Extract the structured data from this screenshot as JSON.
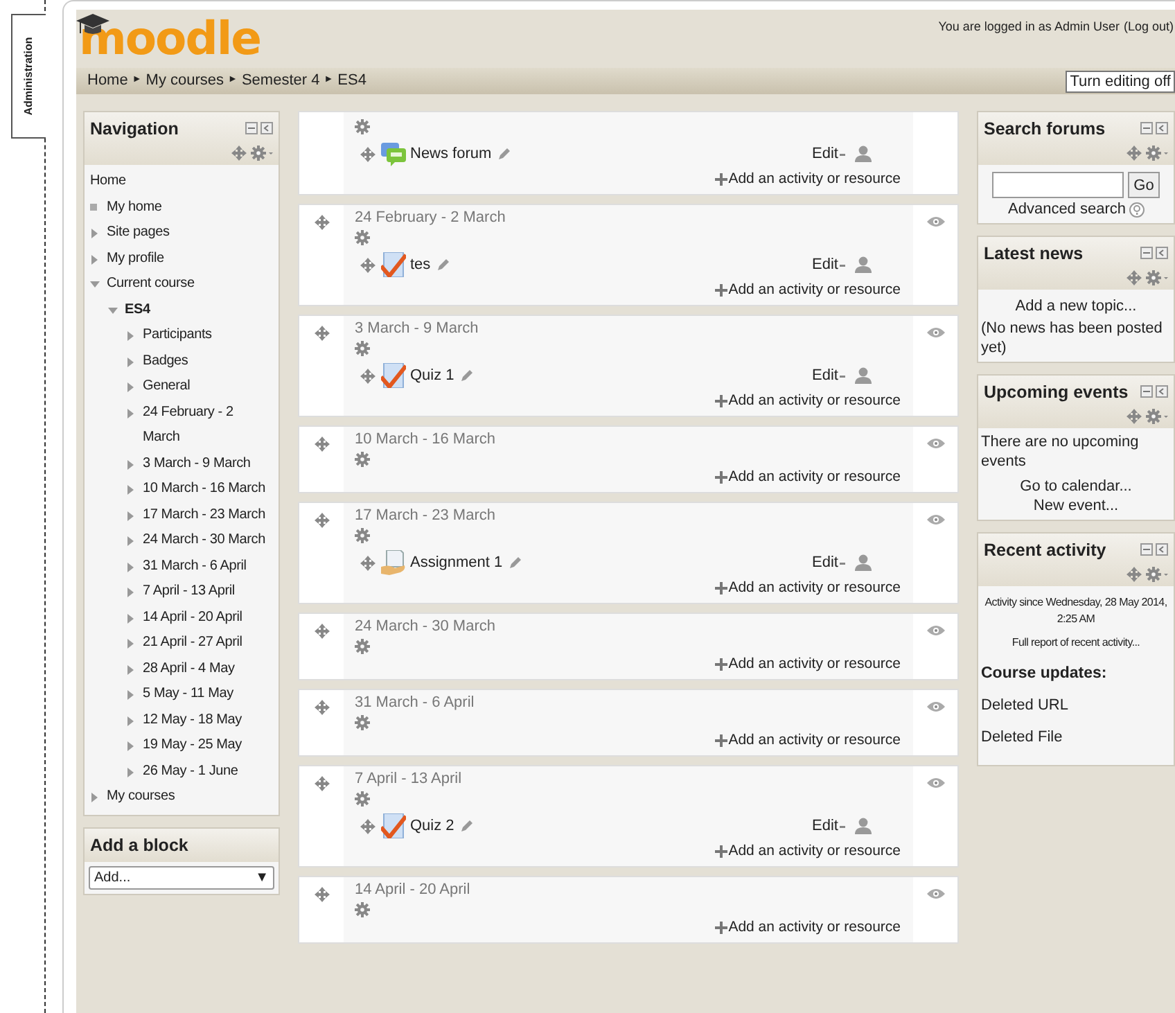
{
  "admin_tab": {
    "label": "Administration"
  },
  "header": {
    "logo": "moodle",
    "login_prefix": "You are logged in as ",
    "user": "Admin User",
    "logout": "(Log out)",
    "breadcrumb": [
      "Home",
      "My courses",
      "Semester 4",
      "ES4"
    ],
    "separator": "►",
    "editing_button": "Turn editing off"
  },
  "nav": {
    "title": "Navigation",
    "home": "Home",
    "items": [
      {
        "label": "My home",
        "kind": "leaf"
      },
      {
        "label": "Site pages",
        "kind": "branch",
        "expanded": false
      },
      {
        "label": "My profile",
        "kind": "branch",
        "expanded": false
      },
      {
        "label": "Current course",
        "kind": "branch",
        "expanded": true,
        "children": [
          {
            "label": "ES4",
            "kind": "branch",
            "expanded": true,
            "bold": true,
            "children": [
              {
                "label": "Participants",
                "kind": "branch",
                "expanded": false
              },
              {
                "label": "Badges",
                "kind": "branch",
                "expanded": false
              },
              {
                "label": "General",
                "kind": "branch",
                "expanded": false
              },
              {
                "label": "24 February - 2 March",
                "kind": "branch",
                "expanded": false
              },
              {
                "label": "3 March - 9 March",
                "kind": "branch",
                "expanded": false
              },
              {
                "label": "10 March - 16 March",
                "kind": "branch",
                "expanded": false
              },
              {
                "label": "17 March - 23 March",
                "kind": "branch",
                "expanded": false
              },
              {
                "label": "24 March - 30 March",
                "kind": "branch",
                "expanded": false
              },
              {
                "label": "31 March - 6 April",
                "kind": "branch",
                "expanded": false
              },
              {
                "label": "7 April - 13 April",
                "kind": "branch",
                "expanded": false
              },
              {
                "label": "14 April - 20 April",
                "kind": "branch",
                "expanded": false
              },
              {
                "label": "21 April - 27 April",
                "kind": "branch",
                "expanded": false
              },
              {
                "label": "28 April - 4 May",
                "kind": "branch",
                "expanded": false
              },
              {
                "label": "5 May - 11 May",
                "kind": "branch",
                "expanded": false
              },
              {
                "label": "12 May - 18 May",
                "kind": "branch",
                "expanded": false
              },
              {
                "label": "19 May - 25 May",
                "kind": "branch",
                "expanded": false
              },
              {
                "label": "26 May - 1 June",
                "kind": "branch",
                "expanded": false
              }
            ]
          }
        ]
      },
      {
        "label": "My courses",
        "kind": "branch",
        "expanded": false
      }
    ]
  },
  "add_block": {
    "title": "Add a block",
    "value": "Add...",
    "arrow": "▼"
  },
  "sections": [
    {
      "activity": {
        "kind": "forum",
        "name": "News forum",
        "edit": "Edit"
      },
      "add": "Add an activity or resource"
    },
    {
      "title": "24 February - 2 March",
      "activity": {
        "kind": "quiz",
        "name": "tes",
        "edit": "Edit"
      },
      "add": "Add an activity or resource"
    },
    {
      "title": "3 March - 9 March",
      "activity": {
        "kind": "quiz",
        "name": "Quiz 1",
        "edit": "Edit"
      },
      "add": "Add an activity or resource"
    },
    {
      "title": "10 March - 16 March",
      "add": "Add an activity or resource"
    },
    {
      "title": "17 March - 23 March",
      "activity": {
        "kind": "assignment",
        "name": "Assignment 1",
        "edit": "Edit"
      },
      "add": "Add an activity or resource"
    },
    {
      "title": "24 March - 30 March",
      "add": "Add an activity or resource"
    },
    {
      "title": "31 March - 6 April",
      "add": "Add an activity or resource"
    },
    {
      "title": "7 April - 13 April",
      "activity": {
        "kind": "quiz",
        "name": "Quiz 2",
        "edit": "Edit"
      },
      "add": "Add an activity or resource"
    },
    {
      "title": "14 April - 20 April",
      "add": "Add an activity or resource"
    }
  ],
  "blocks": [
    {
      "kind": "search",
      "title": "Search forums",
      "button": "Go",
      "link": "Advanced search"
    },
    {
      "kind": "news",
      "title": "Latest news",
      "link": "Add a new topic...",
      "note": "(No news has been posted yet)"
    },
    {
      "kind": "events",
      "title": "Upcoming events",
      "note": "There are no upcoming events",
      "links": [
        "Go to calendar...",
        "New event..."
      ]
    },
    {
      "kind": "recent",
      "title": "Recent activity",
      "since": "Activity since Wednesday, 28 May 2014, 2:25 AM",
      "link": "Full report of recent activity...",
      "heading": "Course updates:",
      "items": [
        "Deleted URL",
        "Deleted File"
      ]
    }
  ]
}
